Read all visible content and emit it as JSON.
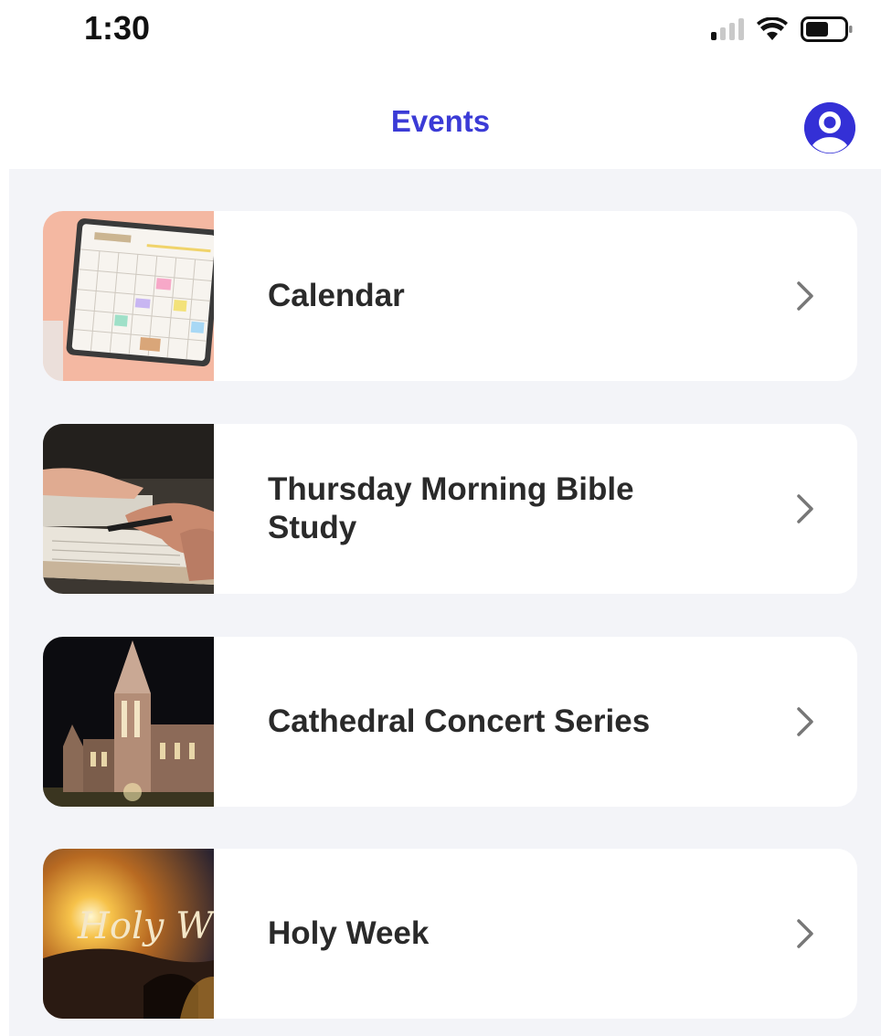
{
  "status_bar": {
    "time": "1:30",
    "icons": [
      "signal-icon",
      "wifi-icon",
      "battery-icon"
    ]
  },
  "nav": {
    "title": "Events",
    "profile_icon": "profile-icon"
  },
  "colors": {
    "accent": "#3b3bd6",
    "background": "#f3f4f8",
    "card": "#ffffff"
  },
  "events": [
    {
      "label": "Calendar",
      "thumbnail": "calendar-photo"
    },
    {
      "label": "Thursday Morning Bible Study",
      "thumbnail": "bible-study-photo"
    },
    {
      "label": "Cathedral Concert Series",
      "thumbnail": "cathedral-photo"
    },
    {
      "label": "Holy Week",
      "thumbnail": "holy-week-photo"
    }
  ],
  "thumb_text": {
    "holy_week": "Holy W"
  }
}
